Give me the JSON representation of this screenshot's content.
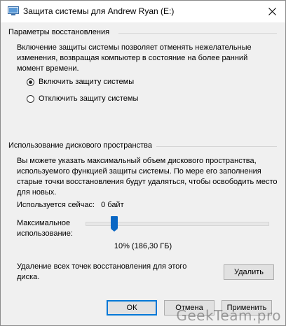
{
  "window": {
    "title": "Защита системы для Andrew Ryan (E:)"
  },
  "restore_settings": {
    "group_title": "Параметры восстановления",
    "description": "Включение защиты системы позволяет отменять нежелательные изменения, возвращая компьютер в состояние на более ранний момент времени.",
    "options": [
      {
        "label": "Включить защиту системы",
        "selected": true
      },
      {
        "label": "Отключить защиту системы",
        "selected": false
      }
    ]
  },
  "disk_usage": {
    "group_title": "Использование дискового пространства",
    "description": "Вы можете указать максимальный объем дискового пространства, используемого функцией защиты системы. По мере его заполнения старые точки восстановления будут удаляться, чтобы освободить место для новых.",
    "current_usage_label": "Используется сейчас:",
    "current_usage_value": "0 байт",
    "max_usage_label": "Максимальное использование:",
    "slider_percent": 10,
    "slider_value_text": "10% (186,30 ГБ)",
    "delete_text": "Удаление всех точек восстановления для этого диска.",
    "delete_button": "Удалить"
  },
  "footer": {
    "ok_button": "ОК",
    "cancel_button": "Отмена",
    "apply_button": "Применить"
  },
  "watermark": "GeekTeam.pro",
  "colors": {
    "accent": "#0a67c4",
    "dialog_bg": "#f0f0f0",
    "button_bg": "#e1e1e1"
  }
}
